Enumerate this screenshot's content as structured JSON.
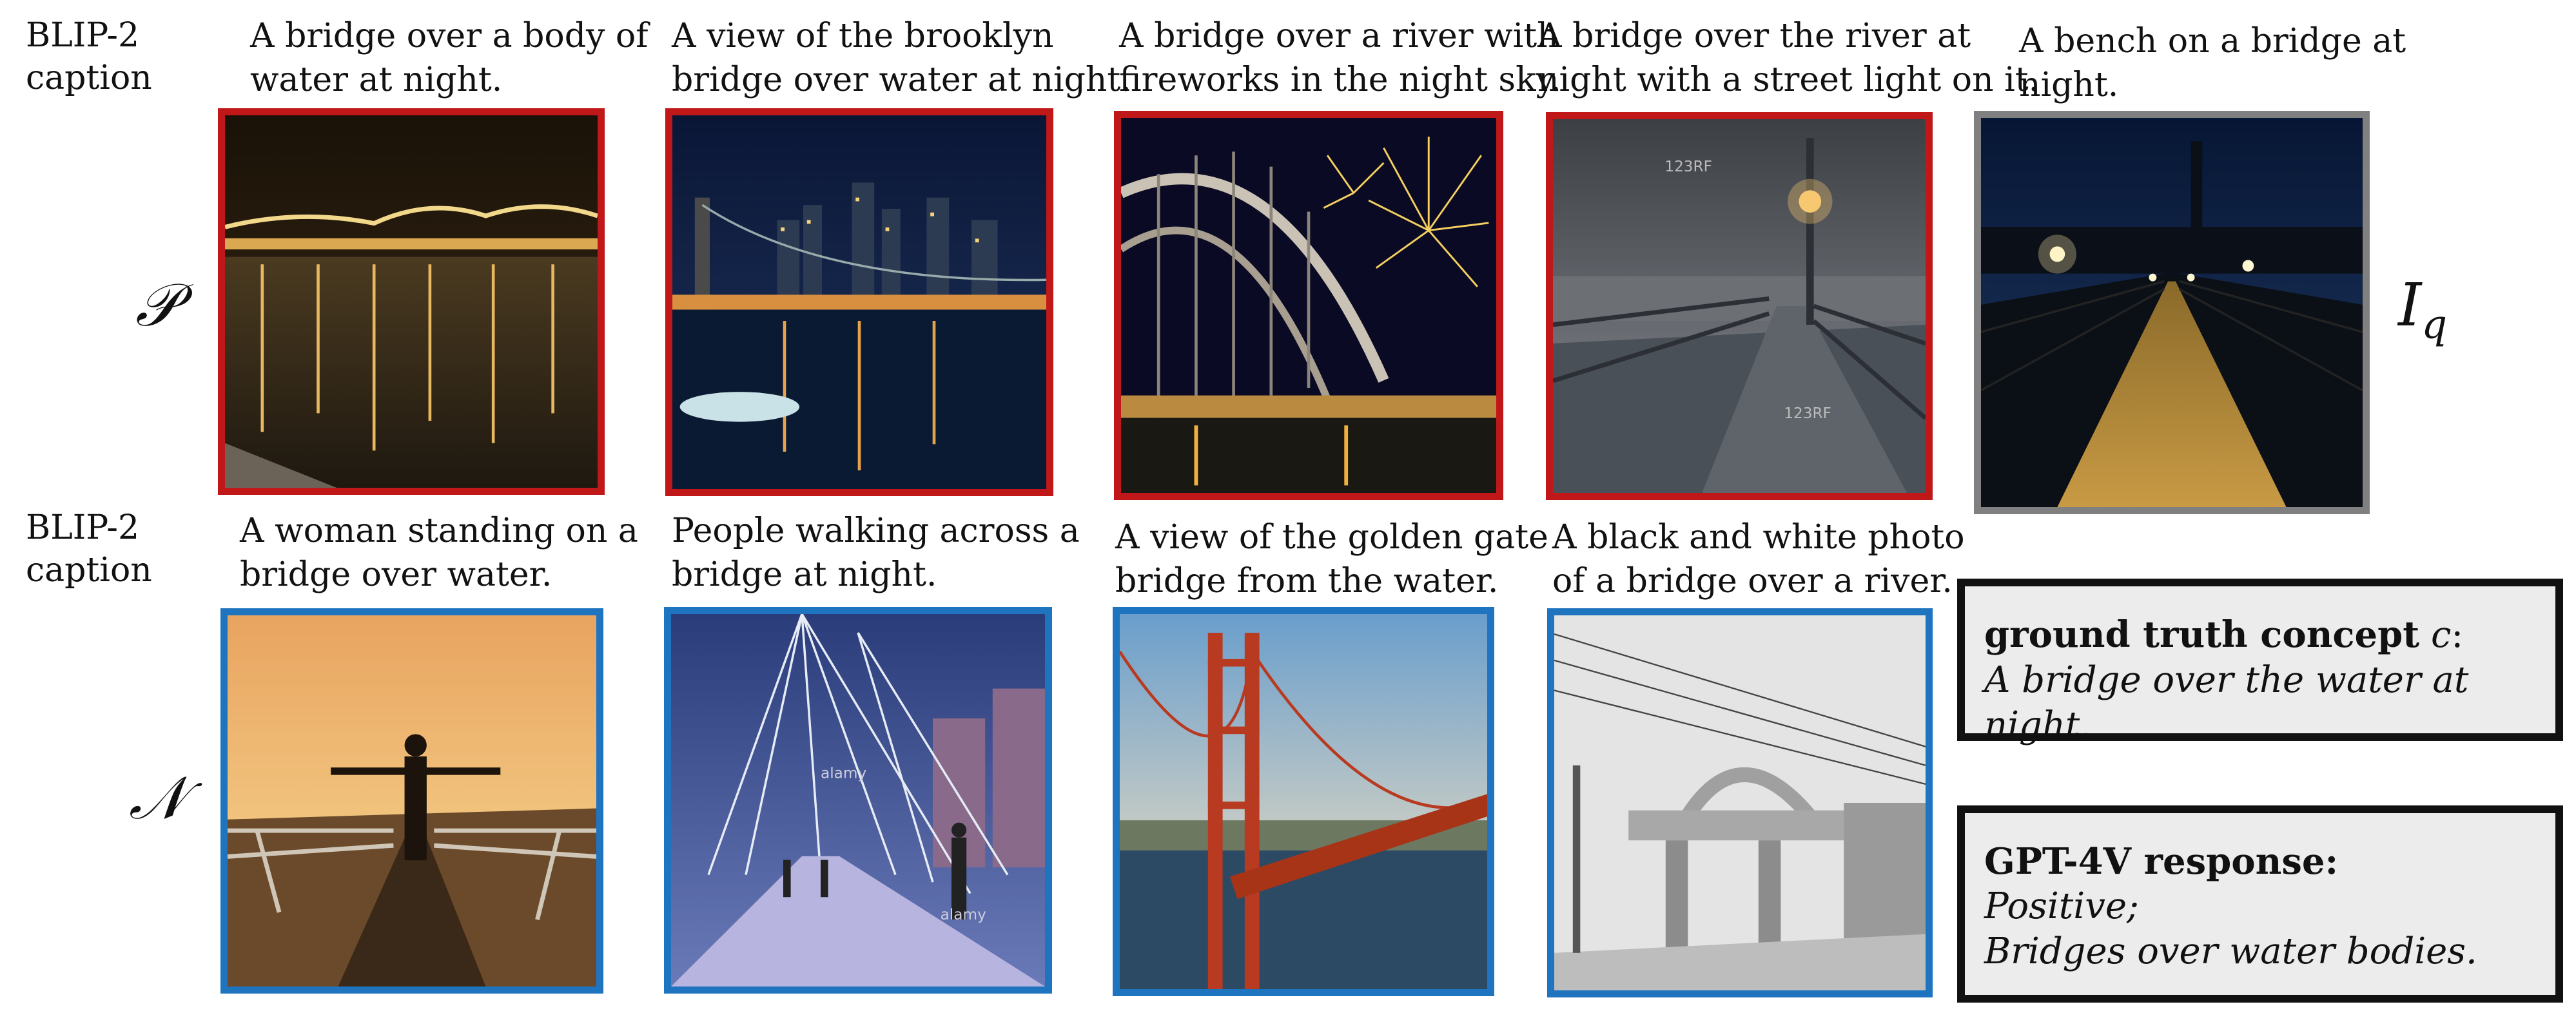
{
  "row_label": "BLIP-2\ncaption",
  "set_symbols": {
    "positive": "𝒫",
    "negative": "𝒩",
    "query": "I",
    "query_sub": "q"
  },
  "colors": {
    "positive_border": "#c01818",
    "negative_border": "#1f74c0",
    "query_border": "#808080"
  },
  "positive_captions": [
    "A bridge over a body of\nwater at night.",
    "A view of the brooklyn\nbridge over water at night.",
    "A bridge over a river with\nfireworks in the night sky.",
    "A bridge over the river at\nnight with a street light on it."
  ],
  "query_caption": "A bench on a bridge at\nnight.",
  "negative_captions": [
    "A woman standing on a\nbridge over water.",
    "People walking across a\nbridge at night.",
    "A view of the golden gate\nbridge from the water.",
    "A black and white photo\nof a bridge over a river."
  ],
  "concept_box": {
    "title": "ground truth concept",
    "variable": "c",
    "colon": ":",
    "text": "A bridge over the water at night."
  },
  "gpt_box": {
    "title": "GPT-4V response:",
    "line1": "Positive;",
    "line2": "Bridges over water bodies."
  },
  "watermarks": {
    "stock1": "123RF",
    "stock2": "alamy"
  }
}
